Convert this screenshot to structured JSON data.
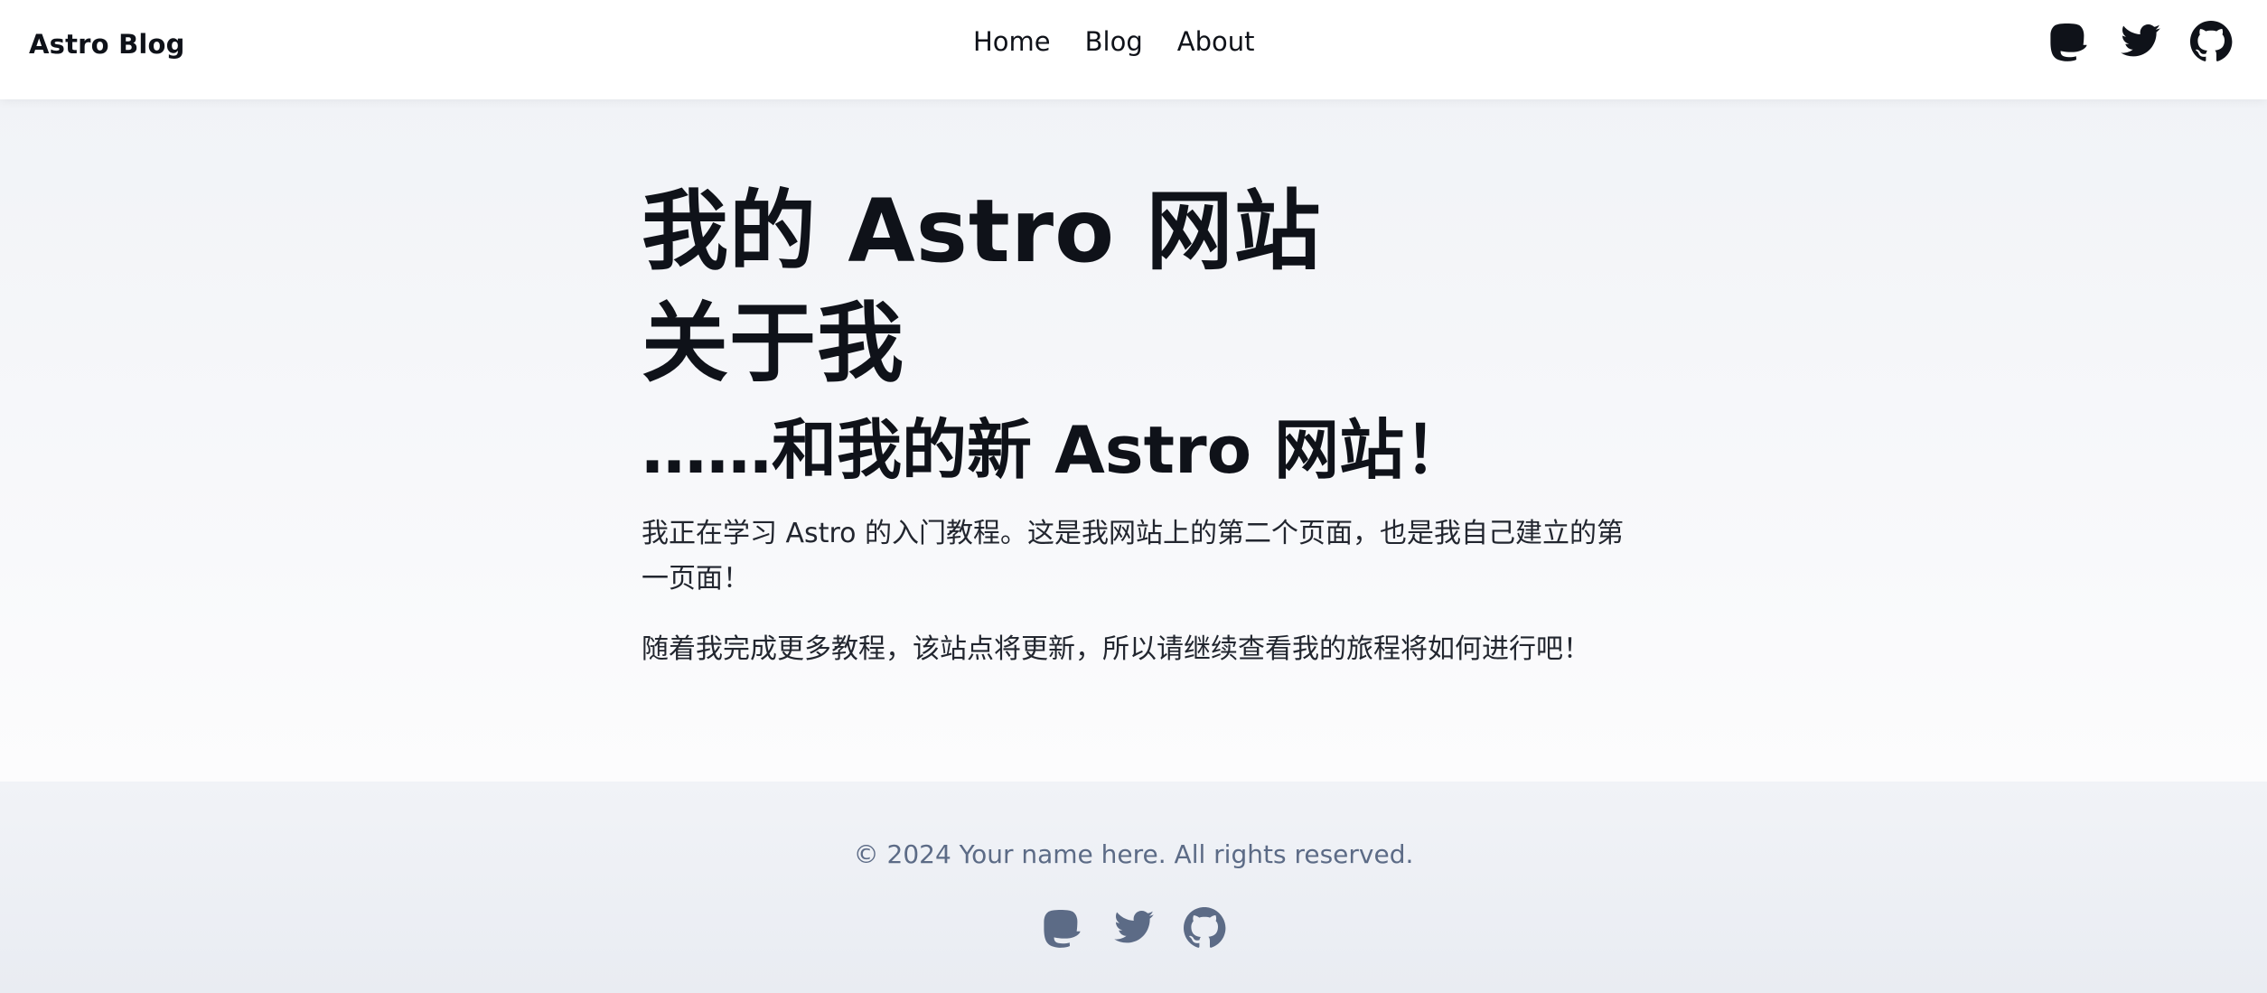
{
  "header": {
    "brand": "Astro Blog",
    "nav": [
      {
        "label": "Home"
      },
      {
        "label": "Blog"
      },
      {
        "label": "About"
      }
    ],
    "social_icons": [
      "mastodon-icon",
      "twitter-icon",
      "github-icon"
    ]
  },
  "main": {
    "title": "我的 Astro 网站",
    "subtitle": "关于我",
    "heading2": "……和我的新 Astro 网站！",
    "paragraphs": [
      "我正在学习 Astro 的入门教程。这是我网站上的第二个页面，也是我自己建立的第一页面！",
      "随着我完成更多教程，该站点将更新，所以请继续查看我的旅程将如何进行吧！"
    ]
  },
  "footer": {
    "copyright": "© 2024 Your name here. All rights reserved.",
    "social_icons": [
      "mastodon-icon",
      "twitter-icon",
      "github-icon"
    ]
  },
  "colors": {
    "text": "#0f1219",
    "muted": "#5c6b86",
    "background_gradient_start": "#f1f3f7"
  }
}
